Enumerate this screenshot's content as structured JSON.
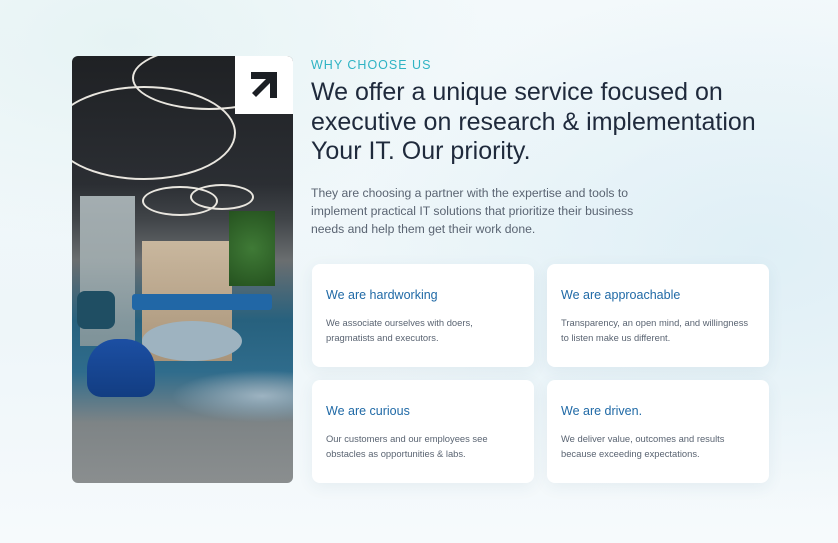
{
  "eyebrow": "WHY CHOOSE US",
  "headline": "We offer a unique service focused on executive on research & implementation Your IT. Our priority.",
  "lede": "They are choosing a partner with the  expertise and tools to implement practical  IT solutions that prioritize their business needs and help them get their work done.",
  "cards": [
    {
      "title": "We are hardworking",
      "body": "We associate  ourselves with doers, pragmatists and  executors."
    },
    {
      "title": "We are approachable",
      "body": "Transparency, an open mind, and willingness  to listen make us  different."
    },
    {
      "title": "We are curious",
      "body": "Our customers and our  employees see obstacles as  opportunities & labs."
    },
    {
      "title": "We are driven.",
      "body": "We  deliver value,  outcomes and results because exceeding  expectations."
    }
  ],
  "colors": {
    "accent": "#2fb3c4",
    "heading": "#1f2a3c",
    "card_title": "#1f69a6",
    "text": "#5a6472"
  },
  "icons": {
    "corner": "diagonal-arrow-icon"
  }
}
